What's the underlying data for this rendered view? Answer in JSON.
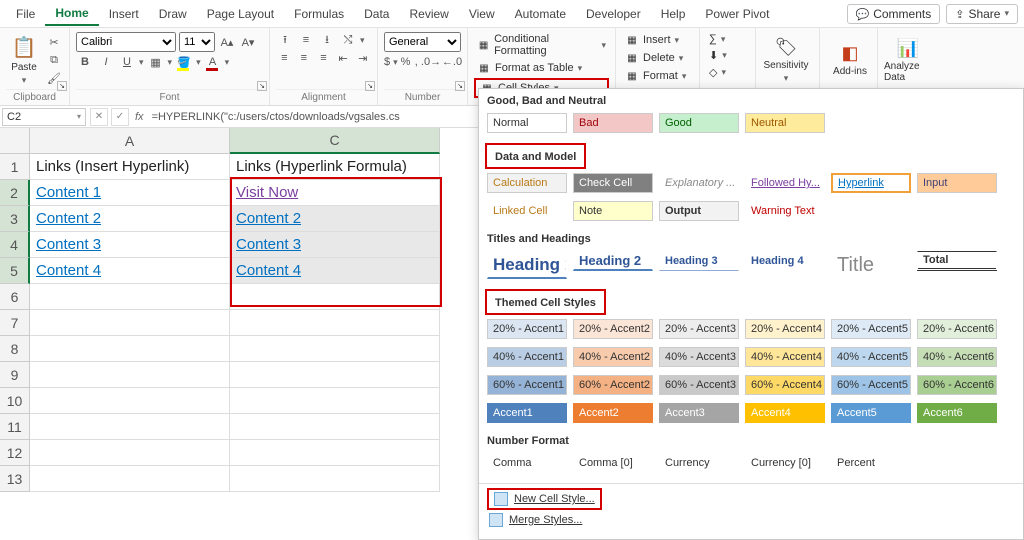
{
  "menubar": {
    "tabs": [
      "File",
      "Home",
      "Insert",
      "Draw",
      "Page Layout",
      "Formulas",
      "Data",
      "Review",
      "View",
      "Automate",
      "Developer",
      "Help",
      "Power Pivot"
    ],
    "active": "Home",
    "comments": "Comments",
    "share": "Share"
  },
  "ribbon": {
    "clipboard": {
      "paste": "Paste",
      "label": "Clipboard"
    },
    "font": {
      "name": "Calibri",
      "size": "11",
      "label": "Font"
    },
    "alignment": {
      "label": "Alignment"
    },
    "number": {
      "format": "General",
      "label": "Number"
    },
    "styles": {
      "conditional": "Conditional Formatting",
      "table": "Format as Table",
      "cellstyles": "Cell Styles"
    },
    "cells": {
      "insert": "Insert",
      "delete": "Delete",
      "format": "Format"
    },
    "sensitivity": "Sensitivity",
    "addins": "Add-ins",
    "analyze": "Analyze Data"
  },
  "formula_bar": {
    "cellref": "C2",
    "formula": "=HYPERLINK(\"c:/users/ctos/downloads/vgsales.cs"
  },
  "sheet": {
    "columns": [
      "A",
      "C"
    ],
    "rows": [
      "1",
      "2",
      "3",
      "4",
      "5",
      "6",
      "7",
      "8",
      "9",
      "10",
      "11",
      "12",
      "13"
    ],
    "headers": {
      "A": "Links (Insert Hyperlink)",
      "C": "Links (Hyperlink Formula)"
    },
    "A": [
      "Content 1",
      "Content 2",
      "Content 3",
      "Content 4"
    ],
    "C": [
      "Visit Now",
      "Content 2",
      "Content 3",
      "Content 4"
    ]
  },
  "gallery": {
    "section1": "Good, Bad and Neutral",
    "s1": {
      "normal": "Normal",
      "bad": "Bad",
      "good": "Good",
      "neutral": "Neutral"
    },
    "section2": "Data and Model",
    "s2": {
      "calculation": "Calculation",
      "check": "Check Cell",
      "explain": "Explanatory ...",
      "followed": "Followed Hy...",
      "hyperlink": "Hyperlink",
      "input": "Input",
      "linked": "Linked Cell",
      "note": "Note",
      "output": "Output",
      "warning": "Warning Text"
    },
    "section3": "Titles and Headings",
    "s3": {
      "h1": "Heading 1",
      "h2": "Heading 2",
      "h3": "Heading 3",
      "h4": "Heading 4",
      "title": "Title",
      "total": "Total"
    },
    "section4": "Themed Cell Styles",
    "accent_pct": [
      "20%",
      "40%",
      "60%"
    ],
    "accent_names": [
      "Accent1",
      "Accent2",
      "Accent3",
      "Accent4",
      "Accent5",
      "Accent6"
    ],
    "section5": "Number Format",
    "s5": {
      "comma": "Comma",
      "comma0": "Comma [0]",
      "currency": "Currency",
      "currency0": "Currency [0]",
      "percent": "Percent"
    },
    "footer": {
      "new": "New Cell Style...",
      "merge": "Merge Styles..."
    }
  },
  "colors": {
    "accent": [
      "#4f81bd",
      "#ed7d31",
      "#a5a5a5",
      "#ffc000",
      "#5b9bd5",
      "#70ad47"
    ],
    "bad": "#f4c7c7",
    "good": "#c6efce",
    "neutral": "#ffeb9c",
    "calc_fg": "#b97a17",
    "check_bg": "#808080",
    "followed": "#7b3fa0",
    "hyperlink": "#0070c0",
    "warning": "#c00000",
    "note_bg": "#ffffcc",
    "output_bg": "#f2f2f2",
    "linked_fg": "#b97a17",
    "input_bg": "#ffcc99"
  }
}
